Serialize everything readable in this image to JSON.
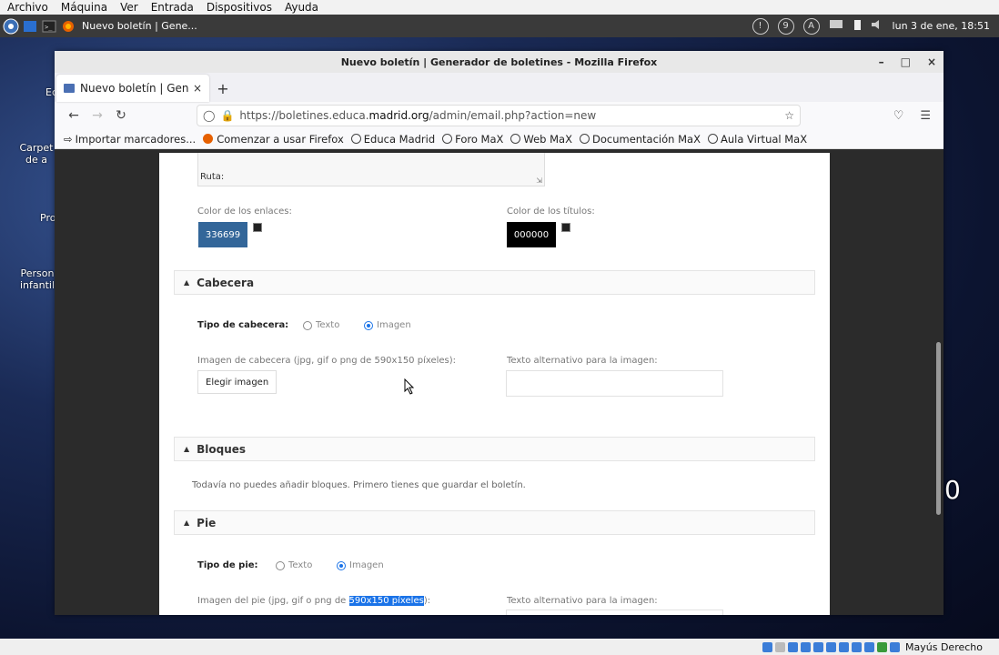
{
  "host_menu": [
    "Archivo",
    "Máquina",
    "Ver",
    "Entrada",
    "Dispositivos",
    "Ayuda"
  ],
  "panel": {
    "task_title": "Nuevo boletín | Gene...",
    "clock": "lun  3 de ene, 18:51",
    "circle_icons": [
      "!",
      "9",
      "A"
    ]
  },
  "desktop": {
    "labels": [
      "Ec",
      "Carpet de a",
      "Pro",
      "Person infantil"
    ],
    "clock_digit": "0"
  },
  "window": {
    "title": "Nuevo boletín | Generador de boletines - Mozilla Firefox",
    "controls": [
      "–",
      "□",
      "×"
    ]
  },
  "tab": {
    "label": "Nuevo boletín | Generado",
    "close": "×",
    "new": "+"
  },
  "url": {
    "prefix": "https://boletines.educa.",
    "domain": "madrid.org",
    "suffix": "/admin/email.php?action=new"
  },
  "bookmarks": [
    "Importar marcadores...",
    "Comenzar a usar Firefox",
    "Educa Madrid",
    "Foro MaX",
    "Web MaX",
    "Documentación MaX",
    "Aula Virtual MaX"
  ],
  "form": {
    "ruta_label": "Ruta:",
    "link_color_label": "Color de los enlaces:",
    "link_color_value": "336699",
    "link_color_hex": "#336699",
    "title_color_label": "Color de los títulos:",
    "title_color_value": "000000",
    "title_color_hex": "#000000",
    "cabecera": {
      "section": "Cabecera",
      "type_label": "Tipo de cabecera:",
      "opt_text": "Texto",
      "opt_image": "Imagen",
      "image_label": "Imagen de cabecera (jpg, gif o png de 590x150 píxeles):",
      "choose_button": "Elegir imagen",
      "alt_label": "Texto alternativo para la imagen:"
    },
    "bloques": {
      "section": "Bloques",
      "message": "Todavía no puedes añadir bloques. Primero tienes que guardar el boletín."
    },
    "pie": {
      "section": "Pie",
      "type_label": "Tipo de pie:",
      "opt_text": "Texto",
      "opt_image": "Imagen",
      "image_label_prefix": "Imagen del pie (jpg, gif o png de ",
      "image_label_highlight": "590x150 píxeles",
      "image_label_suffix": "):",
      "alt_label": "Texto alternativo para la imagen:"
    }
  },
  "statusbar": {
    "text": "Mayús Derecho"
  }
}
